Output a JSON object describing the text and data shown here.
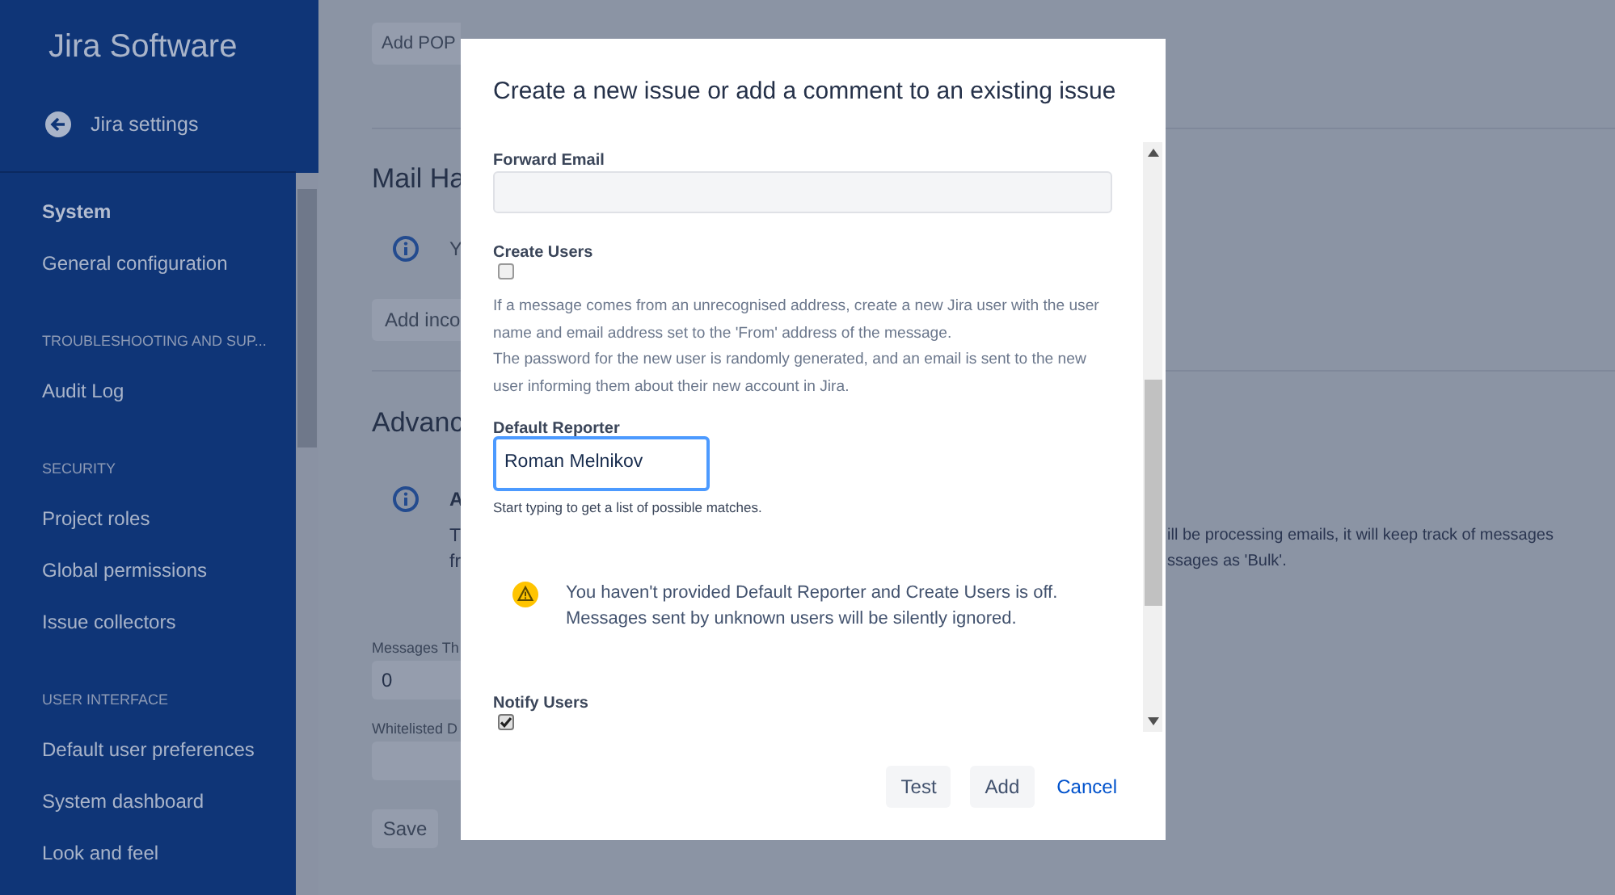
{
  "sidebar": {
    "title": "Jira Software",
    "back_link": "Jira settings",
    "items": [
      {
        "kind": "heading",
        "label": "System"
      },
      {
        "kind": "link",
        "label": "General configuration"
      },
      {
        "kind": "category",
        "label": "TROUBLESHOOTING AND SUP..."
      },
      {
        "kind": "link",
        "label": "Audit Log"
      },
      {
        "kind": "category",
        "label": "SECURITY"
      },
      {
        "kind": "link",
        "label": "Project roles"
      },
      {
        "kind": "link",
        "label": "Global permissions"
      },
      {
        "kind": "link",
        "label": "Issue collectors"
      },
      {
        "kind": "category",
        "label": "USER INTERFACE"
      },
      {
        "kind": "link",
        "label": "Default user preferences"
      },
      {
        "kind": "link",
        "label": "System dashboard"
      },
      {
        "kind": "link",
        "label": "Look and feel"
      }
    ]
  },
  "page": {
    "add_pop_button": "Add POP",
    "mail_heading": "Mail Ha",
    "mail_info": "Y",
    "add_incoming_button": "Add inco",
    "advanced_heading": "Advanc",
    "advanced_info": {
      "title": "A",
      "lines": [
        {
          "left": "T",
          "right": "ill be processing emails, it will keep track of messages"
        },
        {
          "left": "fr",
          "right": "ssages as 'Bulk'."
        }
      ]
    },
    "messages_label": "Messages Th",
    "messages_value": "0",
    "whitelisted_label": "Whitelisted D",
    "save_button": "Save"
  },
  "dialog": {
    "title": "Create a new issue or add a comment to an existing issue",
    "fields": [
      {
        "kind": "text",
        "label": "Forward Email"
      },
      {
        "kind": "checkbox",
        "label": "Create Users",
        "checked": false,
        "description": [
          "If a message comes from an unrecognised address, create a new Jira user with the user name and email address set to the 'From' address of the message.",
          "The password for the new user is randomly generated, and an email is sent to the new user informing them about their new account in Jira."
        ]
      },
      {
        "kind": "user",
        "label": "Default Reporter",
        "value": "Roman Melnikov",
        "help": "Start typing to get a list of possible matches."
      },
      {
        "kind": "warning",
        "text": "You haven't provided Default Reporter and Create Users is off. Messages sent by unknown users will be silently ignored."
      },
      {
        "kind": "checkbox",
        "label": "Notify Users",
        "checked": true
      }
    ],
    "buttons": [
      {
        "kind": "button",
        "label": "Test"
      },
      {
        "kind": "button",
        "label": "Add"
      },
      {
        "kind": "link",
        "label": "Cancel"
      }
    ]
  }
}
